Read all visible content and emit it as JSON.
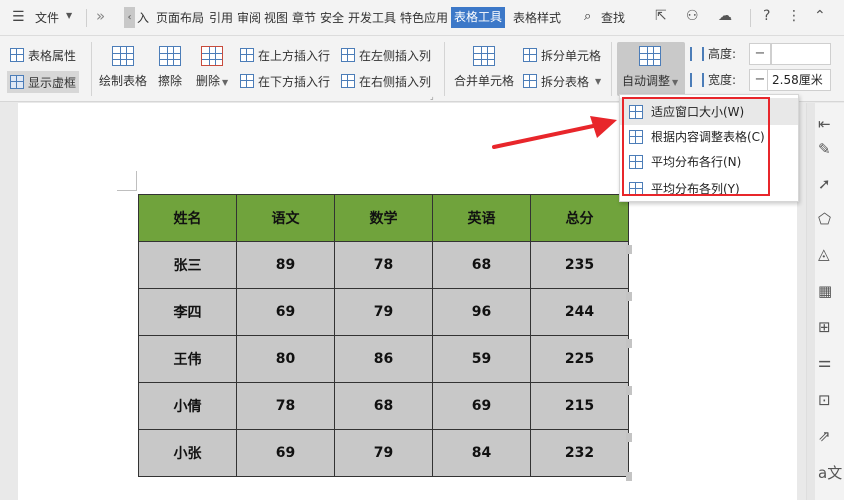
{
  "menubar": {
    "file": "文件",
    "items": [
      "入",
      "页面布局",
      "引用",
      "审阅",
      "视图",
      "章节",
      "安全",
      "开发工具",
      "特色应用"
    ],
    "active_tab": "表格工具",
    "next_tab": "表格样式",
    "search": "查找"
  },
  "ribbon": {
    "table_props": "表格属性",
    "show_gridlines": "显示虚框",
    "draw_table": "绘制表格",
    "erase": "擦除",
    "delete": "删除",
    "insert_above": "在上方插入行",
    "insert_below": "在下方插入行",
    "insert_left": "在左侧插入列",
    "insert_right": "在右侧插入列",
    "merge_cells": "合并单元格",
    "split_cells": "拆分单元格",
    "split_table": "拆分表格",
    "autofit": "自动调整",
    "height_label": "高度:",
    "width_label": "宽度:",
    "height_value": "",
    "width_value": "2.58厘米",
    "minus": "−"
  },
  "dropdown": {
    "items": [
      "适应窗口大小(W)",
      "根据内容调整表格(C)",
      "平均分布各行(N)",
      "平均分布各列(Y)"
    ]
  },
  "table": {
    "headers": [
      "姓名",
      "语文",
      "数学",
      "英语",
      "总分"
    ],
    "rows": [
      [
        "张三",
        "89",
        "78",
        "68",
        "235"
      ],
      [
        "李四",
        "69",
        "79",
        "96",
        "244"
      ],
      [
        "王伟",
        "80",
        "86",
        "59",
        "225"
      ],
      [
        "小倩",
        "78",
        "68",
        "69",
        "215"
      ],
      [
        "小张",
        "69",
        "79",
        "84",
        "232"
      ]
    ]
  },
  "colors": {
    "header_bg": "#70a33c",
    "cell_bg": "#c8c8c8",
    "active_tab": "#3c78c8",
    "highlight": "#e8262b"
  }
}
